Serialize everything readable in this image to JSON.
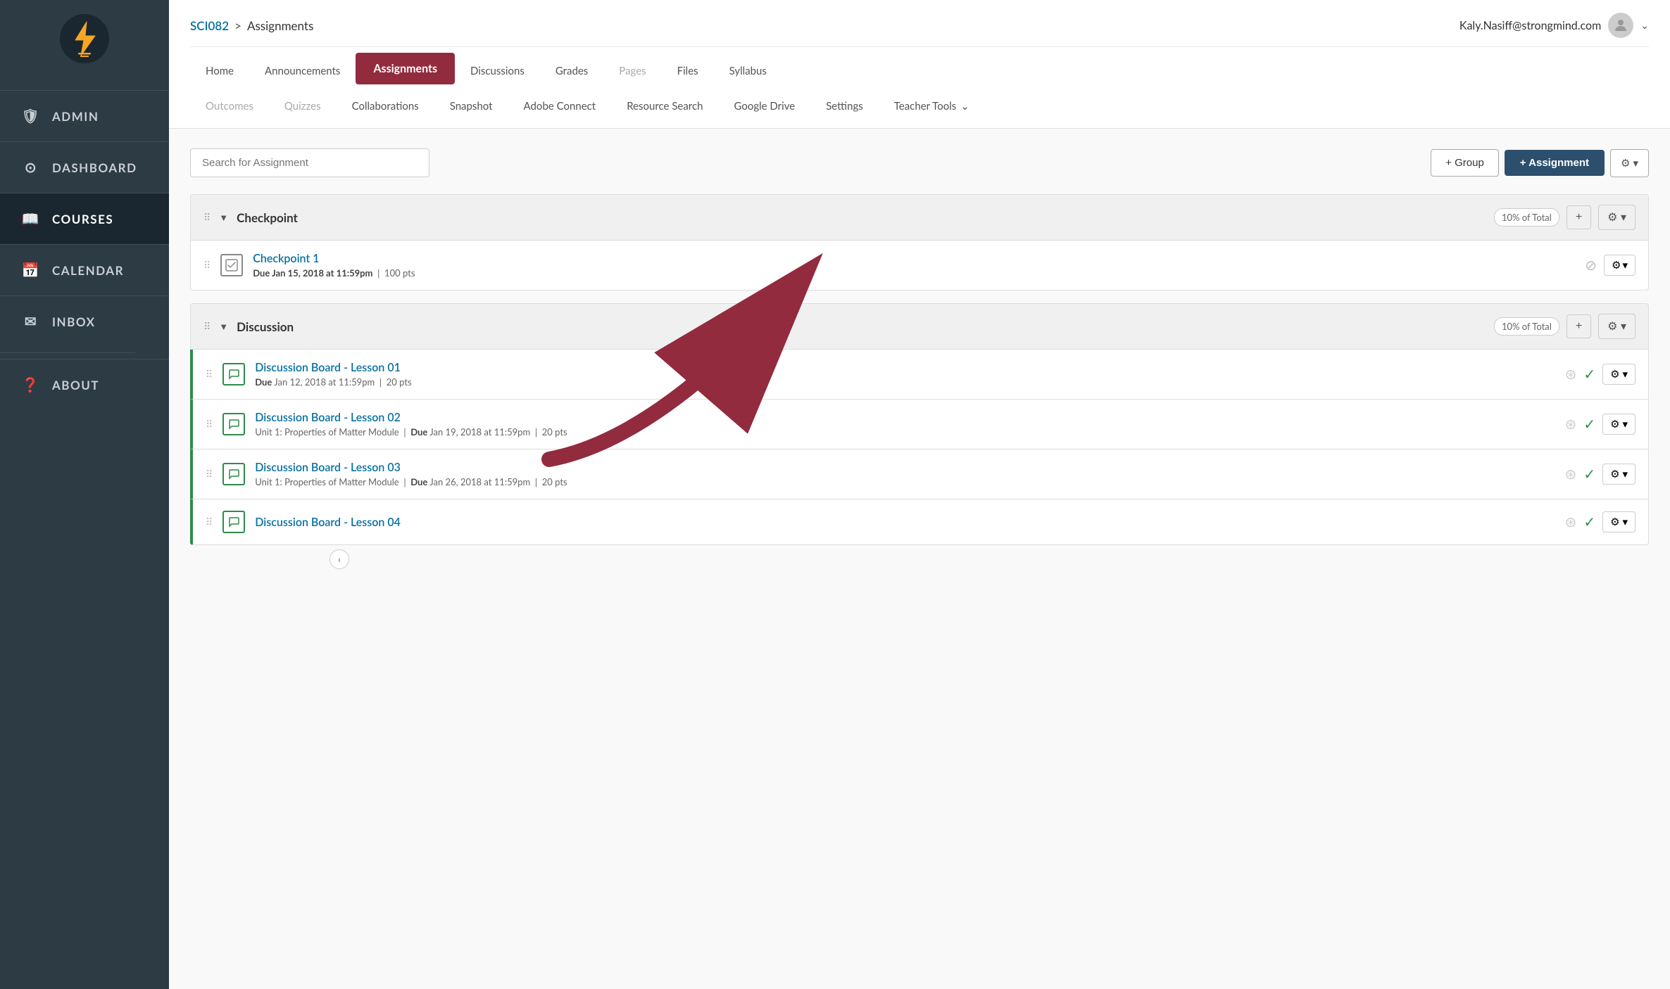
{
  "sidebar": {
    "logo_alt": "Strongmind logo",
    "items": [
      {
        "id": "admin",
        "label": "ADMIN",
        "icon": "🛡",
        "active": false
      },
      {
        "id": "dashboard",
        "label": "DASHBOARD",
        "icon": "⊙",
        "active": false
      },
      {
        "id": "courses",
        "label": "COURSES",
        "icon": "📖",
        "active": true
      },
      {
        "id": "calendar",
        "label": "CALENDAR",
        "icon": "📅",
        "active": false
      },
      {
        "id": "inbox",
        "label": "INBOX",
        "icon": "✉",
        "active": false
      },
      {
        "id": "about",
        "label": "ABOUT",
        "icon": "❓",
        "active": false
      }
    ]
  },
  "topbar": {
    "breadcrumb_link": "SCI082",
    "breadcrumb_sep": ">",
    "breadcrumb_current": "Assignments",
    "user_email": "Kaly.Nasiff@strongmind.com",
    "user_chevron": "⌄"
  },
  "nav": {
    "row1": [
      {
        "id": "home",
        "label": "Home",
        "active": false,
        "muted": false
      },
      {
        "id": "announcements",
        "label": "Announcements",
        "active": false,
        "muted": false
      },
      {
        "id": "assignments",
        "label": "Assignments",
        "active": true,
        "muted": false
      },
      {
        "id": "discussions",
        "label": "Discussions",
        "active": false,
        "muted": false
      },
      {
        "id": "grades",
        "label": "Grades",
        "active": false,
        "muted": false
      },
      {
        "id": "pages",
        "label": "Pages",
        "active": false,
        "muted": true
      },
      {
        "id": "files",
        "label": "Files",
        "active": false,
        "muted": false
      },
      {
        "id": "syllabus",
        "label": "Syllabus",
        "active": false,
        "muted": false
      }
    ],
    "row2": [
      {
        "id": "outcomes",
        "label": "Outcomes",
        "active": false,
        "muted": true
      },
      {
        "id": "quizzes",
        "label": "Quizzes",
        "active": false,
        "muted": true
      },
      {
        "id": "collaborations",
        "label": "Collaborations",
        "active": false,
        "muted": false
      },
      {
        "id": "snapshot",
        "label": "Snapshot",
        "active": false,
        "muted": false
      },
      {
        "id": "adobe-connect",
        "label": "Adobe Connect",
        "active": false,
        "muted": false
      },
      {
        "id": "resource-search",
        "label": "Resource Search",
        "active": false,
        "muted": false
      },
      {
        "id": "google-drive",
        "label": "Google Drive",
        "active": false,
        "muted": false
      }
    ],
    "settings_label": "Settings",
    "teacher_tools_label": "Teacher Tools"
  },
  "toolbar": {
    "search_placeholder": "Search for Assignment",
    "group_btn": "+ Group",
    "assignment_btn": "+ Assignment",
    "settings_btn": "⚙"
  },
  "groups": [
    {
      "id": "checkpoint",
      "title": "Checkpoint",
      "percent": "10% of Total",
      "items": [
        {
          "id": "checkpoint1",
          "name": "Checkpoint 1",
          "due": "Due Jan 15, 2018 at 11:59pm",
          "pts": "100 pts",
          "type": "assignment"
        }
      ]
    },
    {
      "id": "discussion",
      "title": "Discussion",
      "percent": "10% of Total",
      "items": [
        {
          "id": "discussion1",
          "name": "Discussion Board - Lesson 01",
          "due": "Due Jan 12, 2018 at 11:59pm",
          "pts": "20 pts",
          "module": "",
          "type": "discussion"
        },
        {
          "id": "discussion2",
          "name": "Discussion Board - Lesson 02",
          "due": "Due Jan 19, 2018 at 11:59pm",
          "pts": "20 pts",
          "module": "Unit 1: Properties of Matter Module",
          "type": "discussion"
        },
        {
          "id": "discussion3",
          "name": "Discussion Board - Lesson 03",
          "due": "Due Jan 26, 2018 at 11:59pm",
          "pts": "20 pts",
          "module": "Unit 1: Properties of Matter Module",
          "type": "discussion"
        },
        {
          "id": "discussion4",
          "name": "Discussion Board - Lesson 04",
          "due": "",
          "pts": "",
          "module": "",
          "type": "discussion"
        }
      ]
    }
  ]
}
